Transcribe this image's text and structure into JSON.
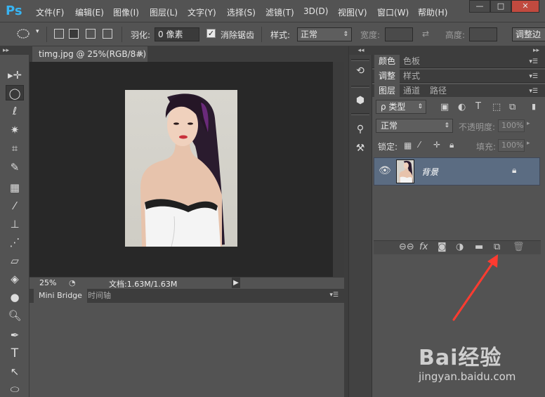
{
  "app": {
    "logo": "Ps"
  },
  "menu": {
    "items": [
      "文件(F)",
      "编辑(E)",
      "图像(I)",
      "图层(L)",
      "文字(Y)",
      "选择(S)",
      "滤镜(T)",
      "3D(D)",
      "视图(V)",
      "窗口(W)",
      "帮助(H)"
    ]
  },
  "window_controls": {
    "minimize": "—",
    "maximize": "□",
    "close": "✕"
  },
  "options": {
    "feather_label": "羽化:",
    "feather_value": "0 像素",
    "antialias_label": "消除锯齿",
    "antialias_checked": true,
    "style_label": "样式:",
    "style_value": "正常",
    "width_label": "宽度:",
    "height_label": "高度:",
    "adjust_edge_button": "调整边"
  },
  "document": {
    "tab_title": "timg.jpg @ 25%(RGB/8#)",
    "close": "×",
    "zoom": "25%",
    "doc_info": "文档:1.63M/1.63M"
  },
  "bridge": {
    "tabs": [
      "Mini Bridge",
      "时间轴"
    ]
  },
  "panels": {
    "color_tabs": [
      "颜色",
      "色板"
    ],
    "adjust_tabs": [
      "调整",
      "样式"
    ],
    "layer_tabs": [
      "图层",
      "通道",
      "路径"
    ],
    "filter_kind": "ρ 类型",
    "blend_mode": "正常",
    "opacity_label": "不透明度:",
    "opacity_value": "100%",
    "lock_label": "锁定:",
    "fill_label": "填充:",
    "fill_value": "100%",
    "layers": [
      {
        "name": "背景",
        "visible": true,
        "locked": true,
        "selected": true
      }
    ]
  },
  "icons": {
    "toolbar": [
      "move-icon",
      "marquee-icon",
      "lasso-icon",
      "magic-wand-icon",
      "crop-icon",
      "eyedropper-icon",
      "healing-brush-icon",
      "brush-icon",
      "clone-stamp-icon",
      "history-brush-icon",
      "eraser-icon",
      "paint-bucket-icon",
      "blur-icon",
      "dodge-icon",
      "pen-icon",
      "type-icon",
      "path-selection-icon",
      "ellipse-shape-icon"
    ]
  },
  "colors": {
    "ps_blue": "#38b4f2",
    "selected_layer": "#5b6c82",
    "arrow": "#ff3b30"
  },
  "watermark": {
    "logo": "Bai经验",
    "url": "jingyan.baidu.com"
  }
}
